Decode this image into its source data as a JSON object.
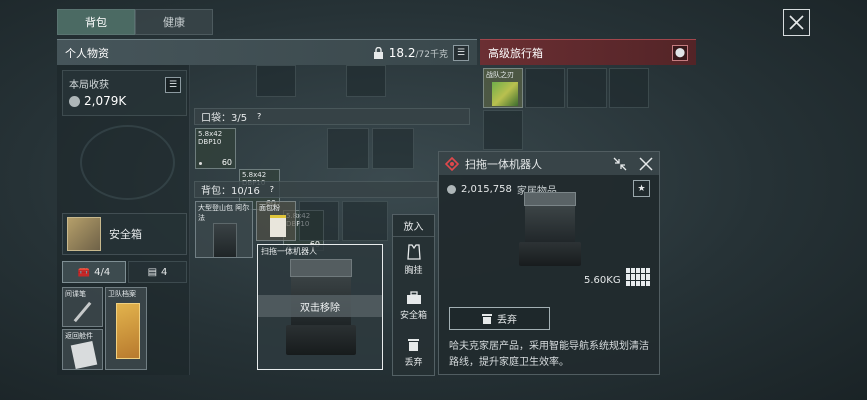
{
  "tabs": [
    {
      "label": "背包",
      "active": true
    },
    {
      "label": "健康",
      "active": false
    }
  ],
  "personal": {
    "title": "个人物资",
    "weight_current": "18.2",
    "weight_max": "/72千克"
  },
  "travel_box": {
    "title": "高级旅行箱",
    "items": [
      {
        "name": "战队之刃"
      }
    ]
  },
  "income": {
    "label": "本局收获",
    "value": "2,079K"
  },
  "safebox": {
    "label": "安全箱"
  },
  "slots": {
    "case_count": "4/4",
    "card_count": "4"
  },
  "side_items": [
    {
      "name": "间谍笔"
    },
    {
      "name": "卫队档案"
    },
    {
      "name": "返回舱件"
    }
  ],
  "pocket": {
    "label": "口袋：3/5",
    "help": "?"
  },
  "ammo": [
    {
      "name": "5.8x42 DBP10",
      "count": "60"
    },
    {
      "name": "5.8x42 DBP10",
      "count": "60"
    },
    {
      "name": "5.8x42 DBP10",
      "count": "60"
    }
  ],
  "backpack": {
    "label": "背包：10/16",
    "help": "?"
  },
  "backpack_items": [
    {
      "name": "大型登山包 阿尔法"
    },
    {
      "name": "面包粉"
    }
  ],
  "selected": {
    "name": "扫拖一体机器人",
    "overlay": "双击移除"
  },
  "menu": {
    "title": "放入",
    "items": [
      {
        "label": "胸挂"
      },
      {
        "label": "安全箱"
      },
      {
        "label": "丢弃"
      }
    ]
  },
  "detail": {
    "title": "扫拖一体机器人",
    "price": "2,015,758",
    "category": "家居物品",
    "weight": "5.60KG",
    "discard": "丢弃",
    "description": "哈夫克家居产品，采用智能导航系统规划清洁路线，提升家庭卫生效率。",
    "accent": "#e0484c"
  }
}
